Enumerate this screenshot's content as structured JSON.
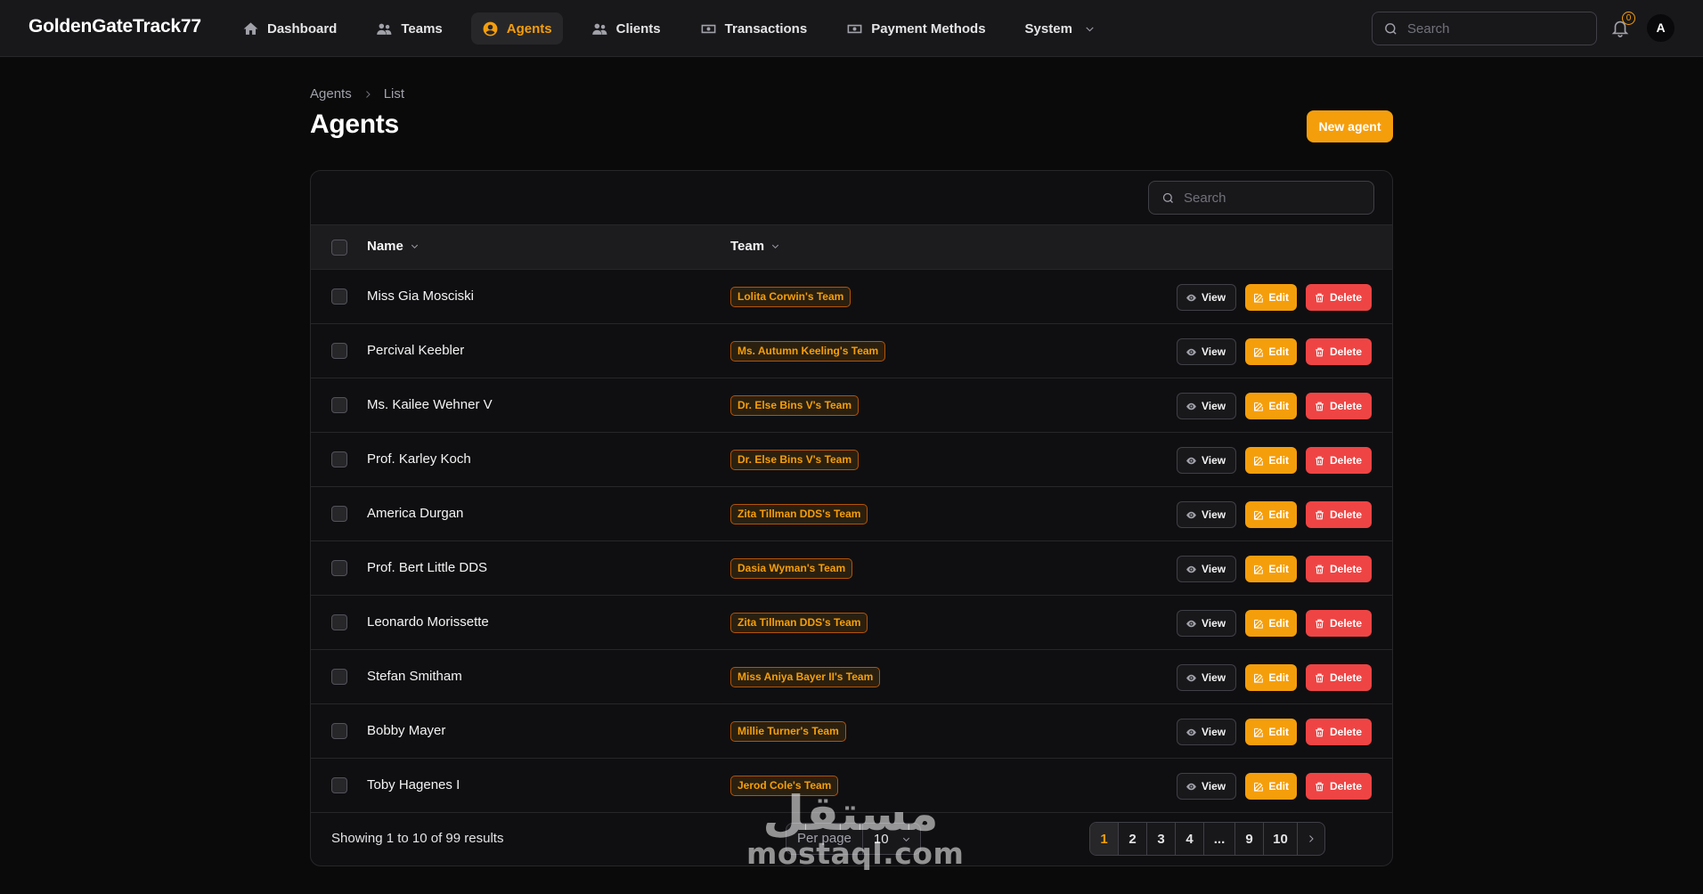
{
  "app": {
    "title": "GoldenGateTrack77"
  },
  "nav": [
    {
      "label": "Dashboard",
      "icon": "home-icon",
      "active": false
    },
    {
      "label": "Teams",
      "icon": "users-icon",
      "active": false
    },
    {
      "label": "Agents",
      "icon": "user-circle-icon",
      "active": true
    },
    {
      "label": "Clients",
      "icon": "users-icon",
      "active": false
    },
    {
      "label": "Transactions",
      "icon": "banknote-icon",
      "active": false
    },
    {
      "label": "Payment Methods",
      "icon": "banknote-icon",
      "active": false
    },
    {
      "label": "System",
      "icon": "chevron-down-icon",
      "active": false
    }
  ],
  "top_search": {
    "placeholder": "Search"
  },
  "notifications": {
    "count": "0"
  },
  "user": {
    "initial": "A"
  },
  "breadcrumb": {
    "parent": "Agents",
    "current": "List"
  },
  "page": {
    "title": "Agents",
    "new_button": "New agent"
  },
  "table": {
    "search_placeholder": "Search",
    "columns": [
      "Name",
      "Team"
    ],
    "actions": {
      "view": "View",
      "edit": "Edit",
      "delete": "Delete"
    },
    "rows": [
      {
        "name": "Miss Gia Mosciski",
        "team": "Lolita Corwin's Team"
      },
      {
        "name": "Percival Keebler",
        "team": "Ms. Autumn Keeling's Team"
      },
      {
        "name": "Ms. Kailee Wehner V",
        "team": "Dr. Else Bins V's Team"
      },
      {
        "name": "Prof. Karley Koch",
        "team": "Dr. Else Bins V's Team"
      },
      {
        "name": "America Durgan",
        "team": "Zita Tillman DDS's Team"
      },
      {
        "name": "Prof. Bert Little DDS",
        "team": "Dasia Wyman's Team"
      },
      {
        "name": "Leonardo Morissette",
        "team": "Zita Tillman DDS's Team"
      },
      {
        "name": "Stefan Smitham",
        "team": "Miss Aniya Bayer II's Team"
      },
      {
        "name": "Bobby Mayer",
        "team": "Millie Turner's Team"
      },
      {
        "name": "Toby Hagenes I",
        "team": "Jerod Cole's Team"
      }
    ]
  },
  "footer": {
    "showing": "Showing 1 to 10 of 99 results",
    "per_page_label": "Per page",
    "per_page_value": "10",
    "pages": [
      "1",
      "2",
      "3",
      "4",
      "...",
      "9",
      "10"
    ],
    "current_page": "1"
  },
  "watermark": {
    "arabic": "مستقل",
    "latin": "mostaql.com"
  },
  "colors": {
    "accent": "#f59e0b",
    "danger": "#ef4444",
    "background": "#0a0a0b",
    "surface": "#18181b"
  }
}
